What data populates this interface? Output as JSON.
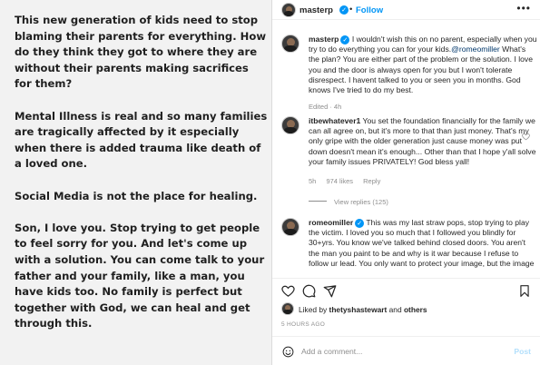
{
  "post_image": {
    "paragraphs": [
      "This new generation of kids need to stop blaming their parents for everything. How do they think they got to where they are without their parents making sacrifices for them?",
      "Mental Illness is real and so many families are tragically affected by it especially when there is added trauma like death of a loved one.",
      "Social Media is not the place for healing.",
      "Son, I love you. Stop trying to get people to feel sorry for you. And let's come up with a solution. You can come talk to your father and your family, like a man, you have kids too. No family is perfect but together with God, we can heal and get through this."
    ]
  },
  "header": {
    "username": "masterp",
    "separator": "•",
    "follow_label": "Follow",
    "more_label": "•••"
  },
  "comments": [
    {
      "username": "masterp",
      "text_before": " I wouldn't wish this on no parent, especially when you try to do everything you can for your kids.",
      "mention": "@romeomiller",
      "text_after": " What's the plan? You are either part of the problem or the solution. I love you and the door is always open for you but I won't tolerate disrespect. I havent talked to you or seen you in months. God knows I've tried to do my best.",
      "meta": [
        "Edited · 4h"
      ]
    },
    {
      "username": "itbewhatever1",
      "text": " You set the foundation financially for the family we can all agree on, but it's more to that than just money. That's my only gripe with the older generation just cause money was put down doesn't mean it's enough... Other than that I hope y'all solve your family issues PRIVATELY! God bless yall!",
      "meta": [
        "5h",
        "974 likes",
        "Reply"
      ],
      "view_replies": "View replies (125)"
    },
    {
      "username": "romeomiller",
      "text": " This was my last straw pops, stop trying to play the victim. I loved you so much that I followed you blindly for 30+yrs. You know we've talked behind closed doors. You aren't the man you paint to be and why is it war because I refuse to follow ur lead. You only want to protect your image, but the image isn't even real. And I don't need anyone to feel sorry for"
    }
  ],
  "likes": {
    "prefix": "Liked by ",
    "user": "thetyshastewart",
    "middle": " and ",
    "others": "others"
  },
  "time_ago": "5 HOURS AGO",
  "add_comment": {
    "placeholder": "Add a comment...",
    "post_label": "Post"
  },
  "colors": {
    "accent": "#0095f6",
    "post_disabled": "#b2dffc",
    "muted": "#8e8e8e"
  }
}
